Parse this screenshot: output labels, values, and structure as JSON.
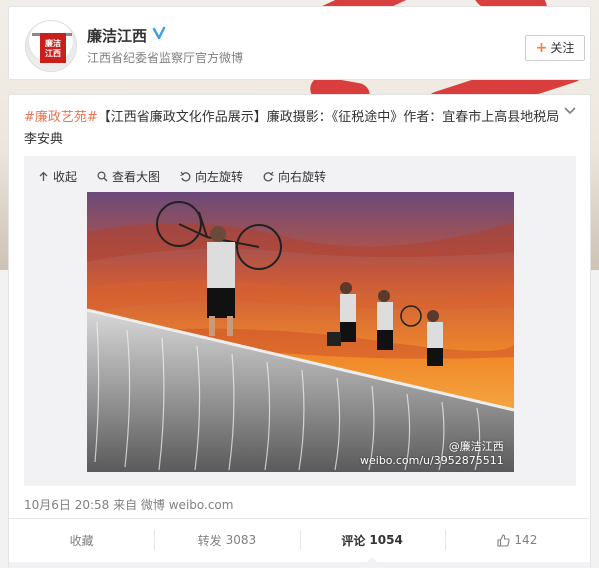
{
  "account": {
    "name": "廉洁江西",
    "description": "江西省纪委省监察厅官方微博",
    "avatar_text": "廉洁\n江西",
    "follow_label": "关注",
    "follow_icon": "plus-icon",
    "verified_icon": "verified-v-icon",
    "verified_color": "#3a9ee6"
  },
  "post": {
    "hashtag": "#廉政艺苑#",
    "text": "【江西省廉政文化作品展示】廉政摄影：《征税途中》作者：宜春市上高县地税局 李安典",
    "hashtag_color": "#eb7350",
    "media_toolbar": [
      {
        "label": "收起",
        "icon": "collapse-up-icon"
      },
      {
        "label": "查看大图",
        "icon": "zoom-icon"
      },
      {
        "label": "向左旋转",
        "icon": "rotate-left-icon"
      },
      {
        "label": "向右旋转",
        "icon": "rotate-right-icon"
      }
    ],
    "watermark_handle": "@廉洁江西",
    "watermark_url": "weibo.com/u/3952875511",
    "meta": "10月6日 20:58 来自 微博 weibo.com"
  },
  "actions": [
    {
      "label": "收藏",
      "count": ""
    },
    {
      "label": "转发",
      "count": "3083"
    },
    {
      "label": "评论",
      "count": "1054"
    },
    {
      "label": "",
      "count": "142",
      "icon": "thumbs-up-icon"
    }
  ]
}
